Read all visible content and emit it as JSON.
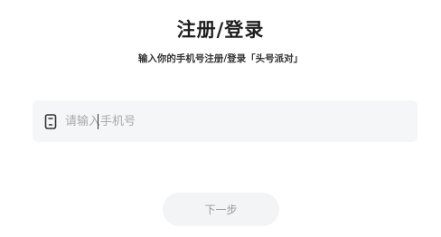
{
  "header": {
    "title": "注册/登录",
    "subtitle": "输入你的手机号注册/登录「头号派对」"
  },
  "phone_field": {
    "icon": "phone-icon",
    "value": "",
    "placeholder": "请输入手机号"
  },
  "next_button": {
    "label": "下一步"
  },
  "colors": {
    "field_background": "#f5f6f7",
    "button_background": "#f3f4f5",
    "button_text": "#9a9a9a",
    "title_text": "#1f1f1f"
  }
}
